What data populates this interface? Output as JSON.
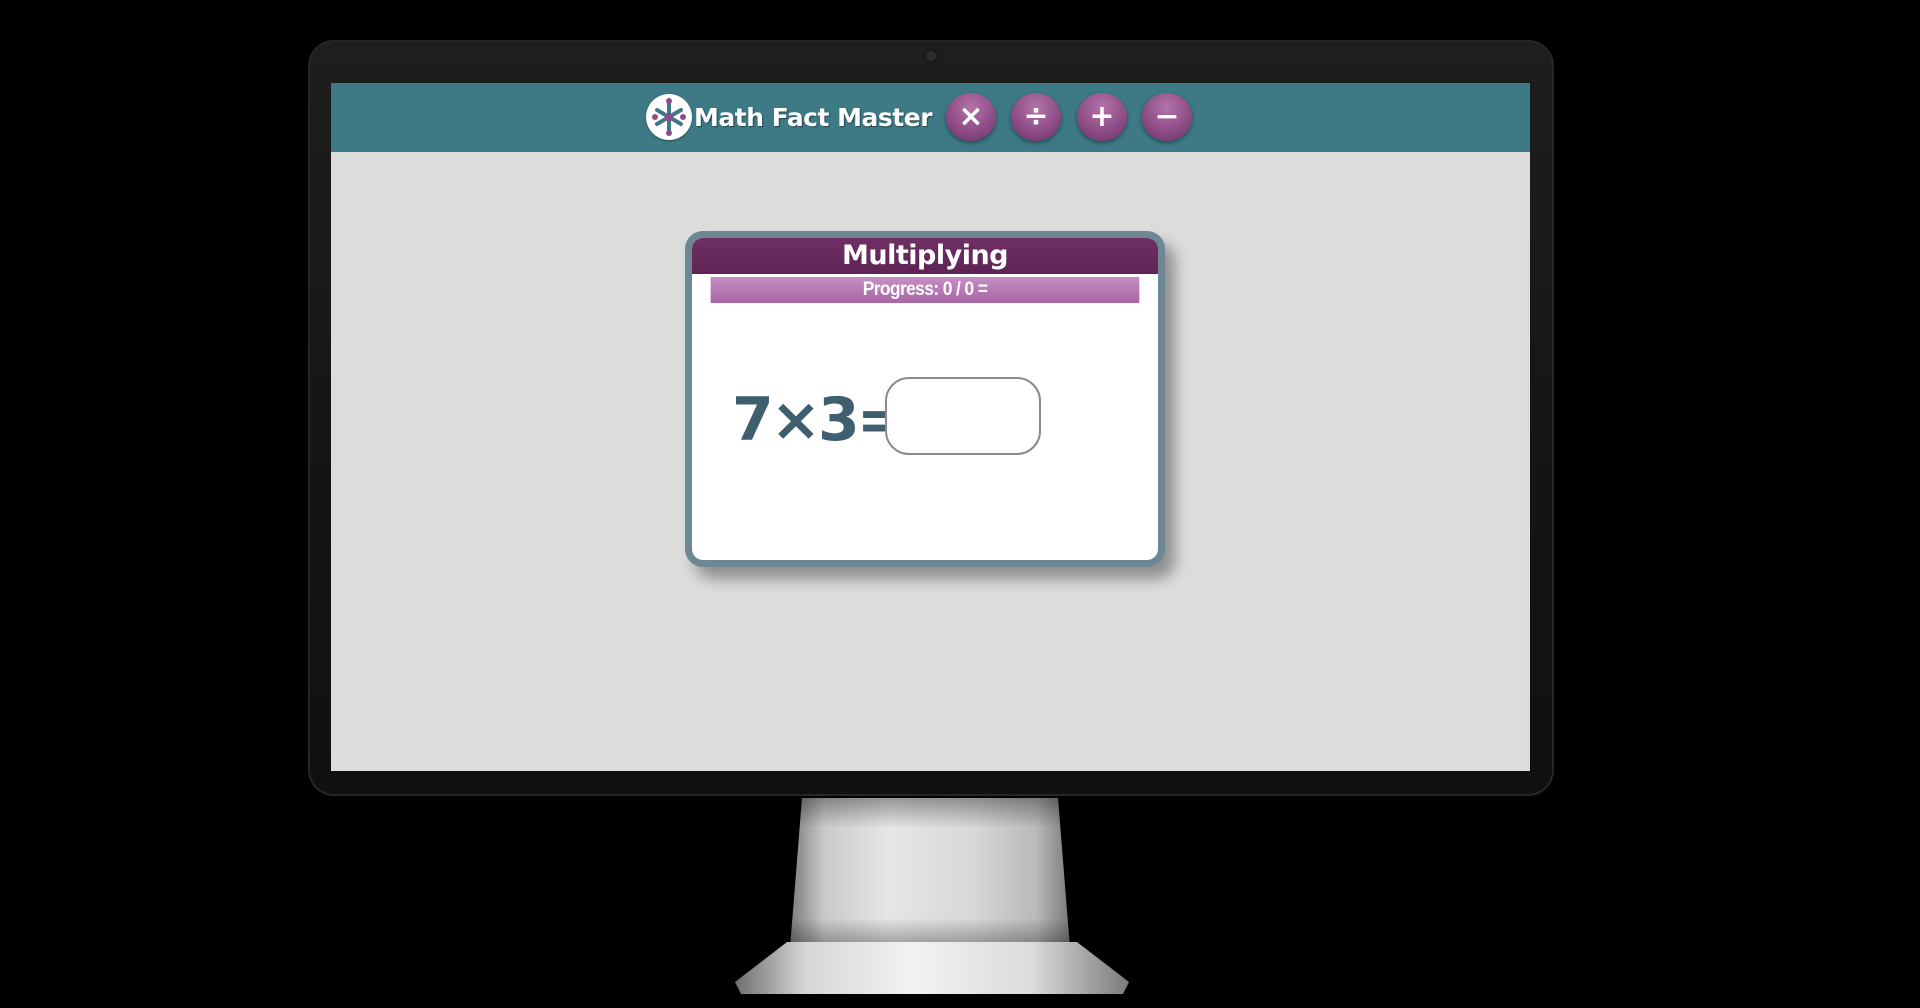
{
  "app": {
    "title": "Math Fact Master",
    "logo_icon": "math-ops-logo-icon"
  },
  "operations": [
    {
      "name": "multiply",
      "symbol": "×",
      "icon": "multiply-icon"
    },
    {
      "name": "divide",
      "symbol": "÷",
      "icon": "divide-icon"
    },
    {
      "name": "add",
      "symbol": "+",
      "icon": "plus-icon"
    },
    {
      "name": "subtract",
      "symbol": "−",
      "icon": "minus-icon"
    }
  ],
  "card": {
    "title": "Multiplying",
    "progress": "Progress: 0 / 0 =",
    "question": "7×3=",
    "answer": {
      "value": "",
      "placeholder": ""
    }
  },
  "colors": {
    "header_teal": "#3d7a85",
    "button_purple": "#8f4d88",
    "card_header_purple": "#6f2f64",
    "progress_purple": "#b676b3",
    "question_text": "#3f5f6f",
    "screen_bg": "#dcdcdc"
  }
}
